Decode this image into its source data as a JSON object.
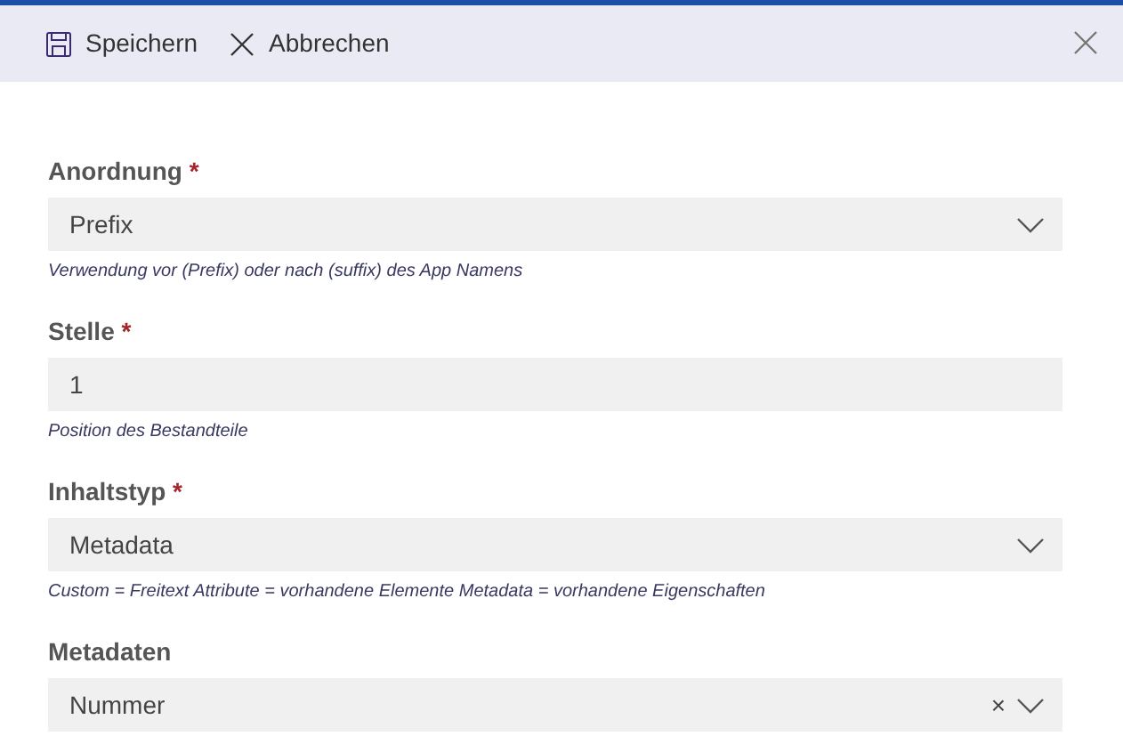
{
  "commands": [
    {
      "kind": "save",
      "label": "Speichern"
    },
    {
      "kind": "cancel",
      "label": "Abbrechen"
    }
  ],
  "fields": [
    {
      "label": "Anordnung",
      "required_mark": "*",
      "kind": "dropdown",
      "value": "Prefix",
      "hint": "Verwendung vor (Prefix) oder nach (suffix) des App Namens"
    },
    {
      "label": "Stelle",
      "required_mark": "*",
      "kind": "text",
      "value": "1",
      "hint": "Position des Bestandteile"
    },
    {
      "label": "Inhaltstyp",
      "required_mark": "*",
      "kind": "dropdown",
      "value": "Metadata",
      "hint": "Custom = Freitext Attribute = vorhandene Elemente Metadata = vorhandene Eigenschaften"
    },
    {
      "label": "Metadaten",
      "kind": "combo",
      "value": "Nummer",
      "clear": "×"
    }
  ]
}
